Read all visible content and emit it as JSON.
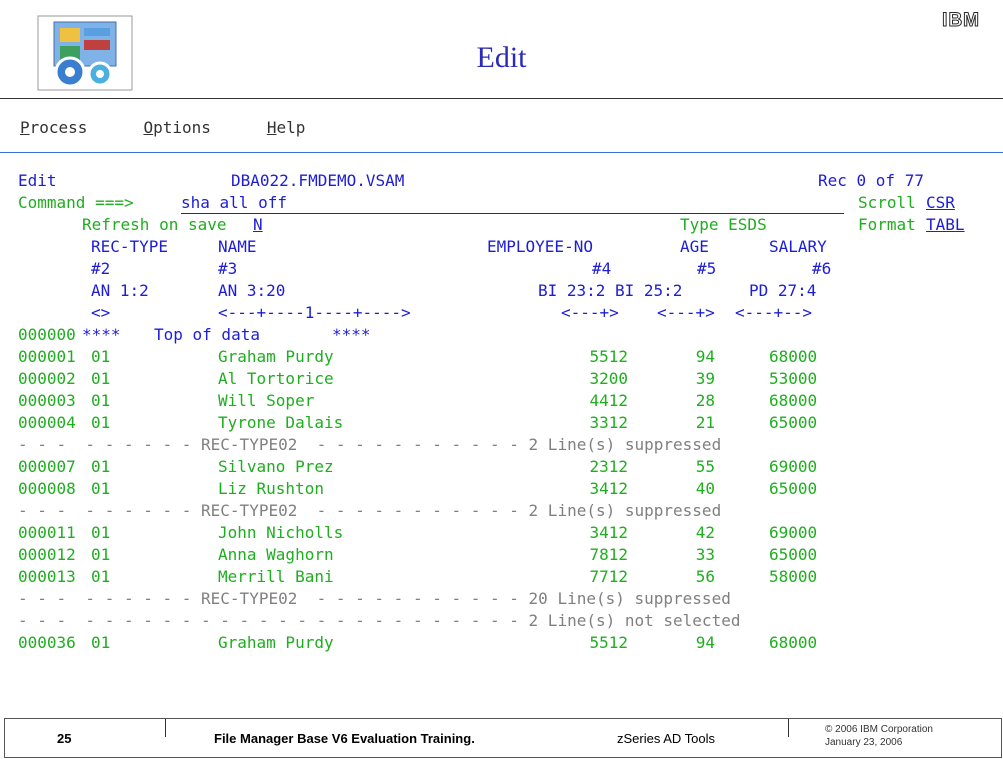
{
  "slide": {
    "title": "Edit",
    "ibm_logo": "IBM",
    "footer": {
      "page_number": "25",
      "course": "File Manager Base V6 Evaluation Training.",
      "tools": "zSeries AD Tools",
      "copyright": "© 2006 IBM Corporation",
      "date": "January 23, 2006"
    }
  },
  "menu": [
    {
      "hot": "P",
      "rest": "rocess"
    },
    {
      "hot": "O",
      "rest": "ptions"
    },
    {
      "hot": "H",
      "rest": "elp"
    }
  ],
  "screen": {
    "mode": "Edit",
    "dataset": "DBA022.FMDEMO.VSAM",
    "rec_position": "Rec 0 of 77",
    "command_label": "Command ===>",
    "command_value": "sha all off",
    "scroll_label": "Scroll",
    "scroll_value": "CSR",
    "refresh_label": "Refresh on save",
    "refresh_value": "N",
    "type_info": "Type ESDS",
    "format_label": "Format",
    "format_value": "TABL",
    "headers": {
      "names": {
        "c1": "REC-TYPE",
        "c2": "NAME",
        "c3": "EMPLOYEE-NO",
        "c4": "AGE",
        "c5": "SALARY"
      },
      "numbers": {
        "c1": "#2",
        "c2": "#3",
        "c3": "#4",
        "c4": "#5",
        "c5": "#6"
      },
      "formats": {
        "c1": "AN 1:2",
        "c2": "AN 3:20",
        "c3": "BI 23:2",
        "c4": "BI 25:2",
        "c5": "PD 27:4"
      },
      "rulers": {
        "c1": "<>",
        "c2": "<---+----1----+---->",
        "c3": "<---+>",
        "c4": "<---+>",
        "c5": "<---+-->"
      }
    },
    "top_marker": {
      "line": "000000",
      "stars": "****",
      "text": "Top of data",
      "stars2": "****"
    },
    "rows": [
      {
        "kind": "data",
        "line": "000001",
        "type": "01",
        "name": "Graham Purdy",
        "emp": "5512",
        "age": "94",
        "salary": "68000"
      },
      {
        "kind": "data",
        "line": "000002",
        "type": "01",
        "name": "Al Tortorice",
        "emp": "3200",
        "age": "39",
        "salary": "53000"
      },
      {
        "kind": "data",
        "line": "000003",
        "type": "01",
        "name": "Will Soper",
        "emp": "4412",
        "age": "28",
        "salary": "68000"
      },
      {
        "kind": "data",
        "line": "000004",
        "type": "01",
        "name": "Tyrone Dalais",
        "emp": "3312",
        "age": "21",
        "salary": "65000"
      },
      {
        "kind": "supp",
        "text": "- - -  - - - - - - REC-TYPE02  - - - - - - - - - - - 2 Line(s) suppressed"
      },
      {
        "kind": "data",
        "line": "000007",
        "type": "01",
        "name": "Silvano Prez",
        "emp": "2312",
        "age": "55",
        "salary": "69000"
      },
      {
        "kind": "data",
        "line": "000008",
        "type": "01",
        "name": "Liz Rushton",
        "emp": "3412",
        "age": "40",
        "salary": "65000"
      },
      {
        "kind": "supp",
        "text": "- - -  - - - - - - REC-TYPE02  - - - - - - - - - - - 2 Line(s) suppressed"
      },
      {
        "kind": "data",
        "line": "000011",
        "type": "01",
        "name": "John Nicholls",
        "emp": "3412",
        "age": "42",
        "salary": "69000"
      },
      {
        "kind": "data",
        "line": "000012",
        "type": "01",
        "name": "Anna Waghorn",
        "emp": "7812",
        "age": "33",
        "salary": "65000"
      },
      {
        "kind": "data",
        "line": "000013",
        "type": "01",
        "name": "Merrill Bani",
        "emp": "7712",
        "age": "56",
        "salary": "58000"
      },
      {
        "kind": "supp",
        "text": "- - -  - - - - - - REC-TYPE02  - - - - - - - - - - - 20 Line(s) suppressed"
      },
      {
        "kind": "supp",
        "text": "- - -  - - - - - - - - - - - - - - - - - - - - - - - 2 Line(s) not selected"
      },
      {
        "kind": "data",
        "line": "000036",
        "type": "01",
        "name": "Graham Purdy",
        "emp": "5512",
        "age": "94",
        "salary": "68000"
      }
    ]
  },
  "colors": {
    "blue": "#1d1dd8",
    "green": "#1fae1f",
    "gray": "#808080",
    "title_blue": "#2a2ab8"
  },
  "icons": {
    "logo": "file-manager-logo",
    "brand": "ibm-logo"
  }
}
